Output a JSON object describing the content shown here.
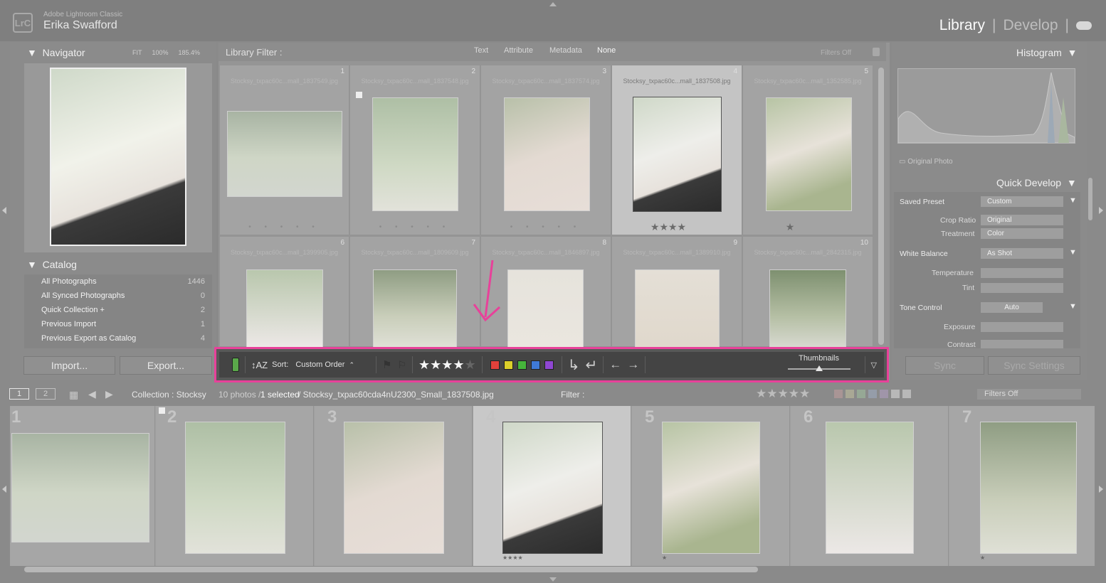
{
  "top": {
    "logo": "LrC",
    "app_name": "Adobe Lightroom Classic",
    "user_name": "Erika Swafford",
    "module_library": "Library",
    "module_develop": "Develop",
    "separator": "|"
  },
  "navigator": {
    "title": "Navigator",
    "fit": "FIT",
    "zoom1": "100%",
    "zoom2": "185.4%"
  },
  "catalog": {
    "title": "Catalog",
    "items": [
      {
        "label": "All Photographs",
        "count": "1446"
      },
      {
        "label": "All Synced Photographs",
        "count": "0"
      },
      {
        "label": "Quick Collection +",
        "count": "2"
      },
      {
        "label": "Previous Import",
        "count": "1"
      },
      {
        "label": "Previous Export as Catalog",
        "count": "4"
      }
    ]
  },
  "left_buttons": {
    "import": "Import...",
    "export": "Export..."
  },
  "library_filter": {
    "label": "Library Filter :",
    "text": "Text",
    "attribute": "Attribute",
    "metadata": "Metadata",
    "none": "None",
    "filters_off": "Filters Off"
  },
  "grid": {
    "cells": [
      {
        "num": "1",
        "name": "Stocksy_txpac60c...mall_1837549.jpg",
        "stars": ""
      },
      {
        "num": "2",
        "name": "Stocksy_txpac60c...mall_1837548.jpg",
        "stars": ""
      },
      {
        "num": "3",
        "name": "Stocksy_txpac60c...mall_1837574.jpg",
        "stars": ""
      },
      {
        "num": "4",
        "name": "Stocksy_txpac60c...mall_1837508.jpg",
        "stars": "★★★★"
      },
      {
        "num": "5",
        "name": "Stocksy_txpac60c...mall_1352585.jpg",
        "stars": "★"
      },
      {
        "num": "6",
        "name": "Stocksy_txpac60c...mall_1399905.jpg",
        "stars": ""
      },
      {
        "num": "7",
        "name": "Stocksy_txpac60c...mall_1809609.jpg",
        "stars": ""
      },
      {
        "num": "8",
        "name": "Stocksy_txpac60c...mall_1846897.jpg",
        "stars": ""
      },
      {
        "num": "9",
        "name": "Stocksy_txpac60c...mall_1389910.jpg",
        "stars": ""
      },
      {
        "num": "10",
        "name": "Stocksy_txpac60c...mall_2842315.jpg",
        "stars": ""
      }
    ]
  },
  "histogram": {
    "title": "Histogram",
    "original_photo": "Original Photo"
  },
  "quick_develop": {
    "title": "Quick Develop",
    "saved_preset_label": "Saved Preset",
    "saved_preset_value": "Custom",
    "crop_ratio_label": "Crop Ratio",
    "crop_ratio_value": "Original",
    "treatment_label": "Treatment",
    "treatment_value": "Color",
    "white_balance_label": "White Balance",
    "white_balance_value": "As Shot",
    "temperature_label": "Temperature",
    "tint_label": "Tint",
    "tone_control_label": "Tone Control",
    "auto": "Auto",
    "exposure_label": "Exposure",
    "contrast_label": "Contrast"
  },
  "sync": {
    "sync": "Sync",
    "sync_settings": "Sync Settings"
  },
  "toolbar": {
    "sort_label": "Sort:",
    "sort_value": "Custom Order",
    "rating_stars": "★★★★",
    "rating_empty": "★",
    "thumbnails_label": "Thumbnails",
    "thumbnail_size": 0.5,
    "colors": [
      "#e0413b",
      "#dcd02a",
      "#46b43b",
      "#3f79d6",
      "#8f47d2"
    ]
  },
  "filmstrip_bar": {
    "view1": "1",
    "view2": "2",
    "collection": "Collection : Stocksy",
    "count": "10 photos /",
    "selected": "1 selected",
    "filename": "/ Stocksy_txpac60cda4nU2300_Small_1837508.jpg",
    "filter_label": "Filter :",
    "filters_off": "Filters Off"
  },
  "filmstrip": {
    "cells": [
      {
        "num": "1",
        "stars": ""
      },
      {
        "num": "2",
        "stars": ""
      },
      {
        "num": "3",
        "stars": ""
      },
      {
        "num": "4",
        "stars": "★★★★"
      },
      {
        "num": "5",
        "stars": "★"
      },
      {
        "num": "6",
        "stars": ""
      },
      {
        "num": "7",
        "stars": "★"
      }
    ]
  }
}
